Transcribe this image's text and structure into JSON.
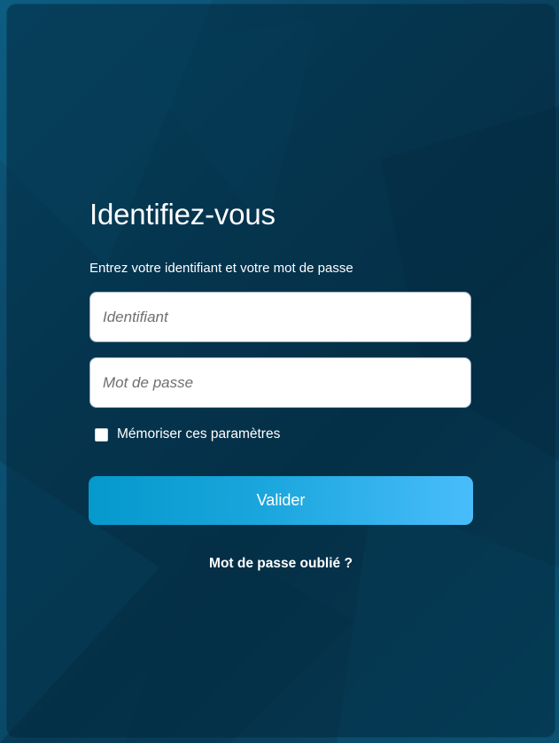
{
  "login": {
    "title": "Identifiez-vous",
    "subtitle": "Entrez votre identifiant et votre mot de passe",
    "username_placeholder": "Identifiant",
    "username_value": "",
    "password_placeholder": "Mot de passe",
    "password_value": "",
    "remember_label": "Mémoriser ces paramètres",
    "remember_checked": false,
    "submit_label": "Valider",
    "forgot_label": "Mot de passe oublié ?"
  },
  "colors": {
    "background": "#0a4a6a",
    "button_start": "#0599cc",
    "button_end": "#49bdfb",
    "text": "#ffffff"
  }
}
